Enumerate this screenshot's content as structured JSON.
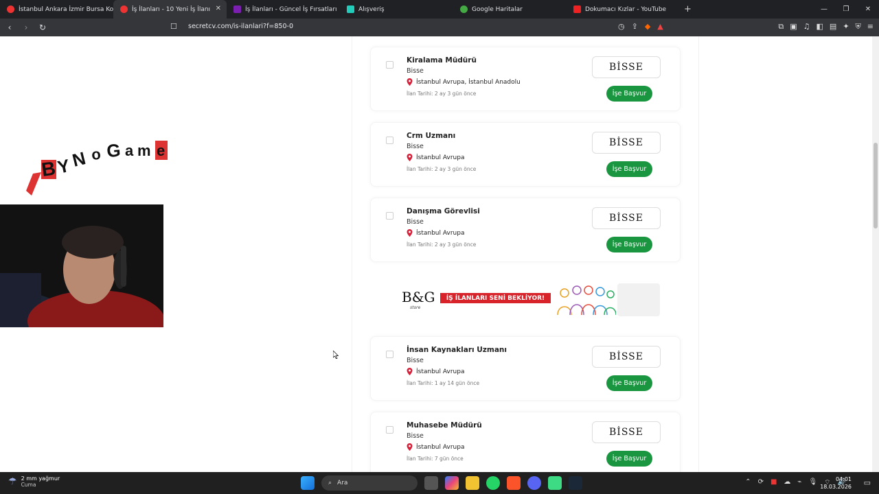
{
  "browser": {
    "tabs": [
      {
        "label": "İstanbul Ankara İzmir Bursa Kocaeli A",
        "active": false,
        "color": "#e33"
      },
      {
        "label": "İş İlanları - 10 Yeni İş İlanı",
        "active": true,
        "color": "#e33"
      },
      {
        "label": "İş İlanları - Güncel İş Fırsatları",
        "active": false,
        "color": "#7b2"
      },
      {
        "label": "Alışveriş",
        "active": false,
        "color": "#2cb"
      },
      {
        "label": "Google Haritalar",
        "active": false,
        "color": "#4a4"
      },
      {
        "label": "Dokumacı Kızlar - YouTube",
        "active": false,
        "color": "#e22"
      }
    ],
    "url": "secretcv.com/is-ilanlari?f=850-0"
  },
  "jobs": [
    {
      "title": "Kiralama Müdürü",
      "company": "Bisse",
      "location": "İstanbul Avrupa, İstanbul Anadolu",
      "date": "İlan Tarihi: 2 ay 3 gün önce",
      "logo": "BİSSE",
      "apply": "İşe Başvur"
    },
    {
      "title": "Crm Uzmanı",
      "company": "Bisse",
      "location": "İstanbul Avrupa",
      "date": "İlan Tarihi: 2 ay 3 gün önce",
      "logo": "BİSSE",
      "apply": "İşe Başvur"
    },
    {
      "title": "Danışma Görevlisi",
      "company": "Bisse",
      "location": "İstanbul Avrupa",
      "date": "İlan Tarihi: 2 ay 3 gün önce",
      "logo": "BİSSE",
      "apply": "İşe Başvur"
    },
    {
      "title": "İnsan Kaynakları Uzmanı",
      "company": "Bisse",
      "location": "İstanbul Avrupa",
      "date": "İlan Tarihi: 1 ay 14 gün önce",
      "logo": "BİSSE",
      "apply": "İşe Başvur"
    },
    {
      "title": "Muhasebe Müdürü",
      "company": "Bisse",
      "location": "İstanbul Avrupa",
      "date": "İlan Tarihi: 7 gün önce",
      "logo": "BİSSE",
      "apply": "İşe Başvur"
    }
  ],
  "banner": {
    "brand": "B&G",
    "store": "store",
    "headline": "İŞ İLANLARI SENİ BEKLİYOR!"
  },
  "overlay": {
    "streamer_logo": "BYNoGame"
  },
  "taskbar": {
    "weather": {
      "temp": "2 mm yağmur",
      "day": "Cuma"
    },
    "search_placeholder": "Ara",
    "time": "04:01",
    "date": "18.03.2026"
  },
  "colors": {
    "apply_green": "#1a9641",
    "pin_red": "#d6213a",
    "banner_red": "#d8232a"
  }
}
